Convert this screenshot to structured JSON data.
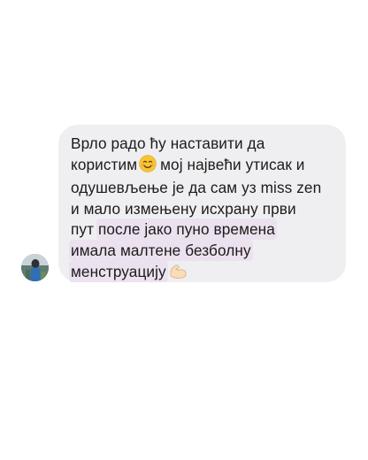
{
  "message": {
    "lines": [
      "Врло радо ћу наставити да",
      "користим",
      "мој највећи утисак и",
      "одушевљење је да сам уз miss zen",
      "и мало измењену исхрану први",
      "пут",
      "после јако пуно времена",
      "имала малтене безболну",
      "менструацију"
    ],
    "emojis": [
      "smiling-face-emoji",
      "flexed-biceps-emoji"
    ]
  },
  "colors": {
    "bubble_background": "#efeff1",
    "highlight": "#ece1ee",
    "text": "#1b1b1b"
  }
}
